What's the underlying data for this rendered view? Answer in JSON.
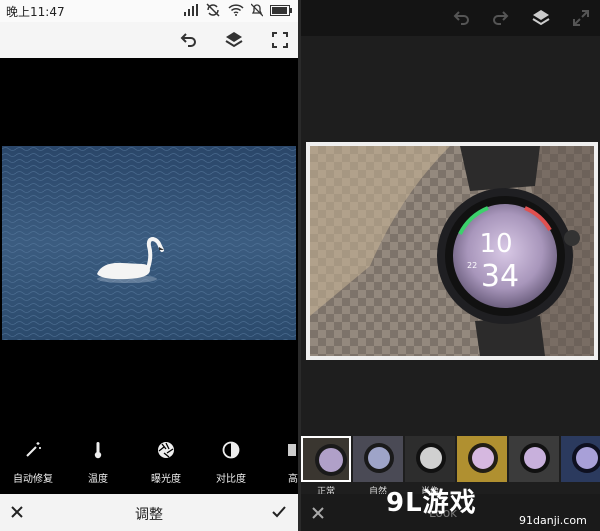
{
  "status_bar": {
    "time": "晚上11:47"
  },
  "adjust_panel": {
    "tools": [
      {
        "label": "自动修复",
        "icon": "magic-wand-icon"
      },
      {
        "label": "温度",
        "icon": "thermometer-icon"
      },
      {
        "label": "曝光度",
        "icon": "aperture-icon"
      },
      {
        "label": "对比度",
        "icon": "contrast-icon"
      },
      {
        "label": "高",
        "icon": "partial-tool-icon"
      }
    ],
    "title": "调整"
  },
  "look_panel": {
    "filters": [
      {
        "label": "正常",
        "selected": true
      },
      {
        "label": "",
        "selected": false
      },
      {
        "label": "自然",
        "selected": false
      },
      {
        "label": "肖像",
        "selected": false
      },
      {
        "label": "",
        "selected": false
      },
      {
        "label": "",
        "selected": false
      }
    ],
    "title": "Look"
  },
  "watch_face": {
    "hour": "10",
    "minute": "34",
    "side_text": "22"
  },
  "watermark": {
    "brand": "9L游戏",
    "url": "91danji.com"
  },
  "colors": {
    "light_bar": "#f3f3f3",
    "dark_bar": "#1e1e1e",
    "water": "#2f4c6e"
  }
}
